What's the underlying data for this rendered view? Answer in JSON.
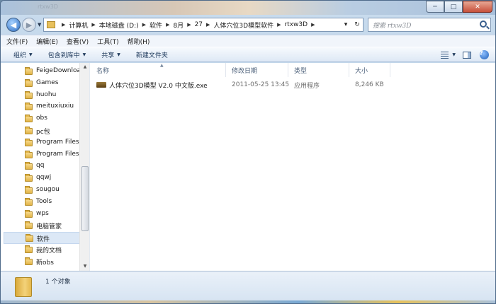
{
  "title_blur": "rtxw3D",
  "caption": {
    "min": "─",
    "max": "□",
    "close": "✕"
  },
  "nav": {
    "back": "◀",
    "forward": "▶",
    "dropdown": "▼"
  },
  "address": {
    "segments": [
      "计算机",
      "本地磁盘 (D:)",
      "软件",
      "8月",
      "27",
      "人体穴位3D模型软件",
      "rtxw3D"
    ],
    "refresh": "↻",
    "dropdown": "▾"
  },
  "search": {
    "placeholder": "搜索 rtxw3D"
  },
  "menu": [
    "文件(F)",
    "编辑(E)",
    "查看(V)",
    "工具(T)",
    "帮助(H)"
  ],
  "commands": [
    {
      "label": "组织",
      "dropdown": true
    },
    {
      "label": "包含到库中",
      "dropdown": true
    },
    {
      "label": "共享",
      "dropdown": true
    },
    {
      "label": "新建文件夹",
      "dropdown": false
    }
  ],
  "tree": [
    "FeigeDownloa",
    "Games",
    "huohu",
    "meituxiuxiu",
    "obs",
    "pc包",
    "Program Files",
    "Program Files",
    "qq",
    "qqwj",
    "sougou",
    "Tools",
    "wps",
    "电脑管家",
    "软件",
    "我的文档",
    "新obs"
  ],
  "tree_selected_index": 14,
  "columns": {
    "name": "名称",
    "modified": "修改日期",
    "type": "类型",
    "size": "大小"
  },
  "files": [
    {
      "name": "人体穴位3D模型 V2.0 中文版.exe",
      "modified": "2011-05-25 13:45",
      "type": "应用程序",
      "size": "8,246 KB"
    }
  ],
  "status": {
    "count": "1 个对象"
  }
}
